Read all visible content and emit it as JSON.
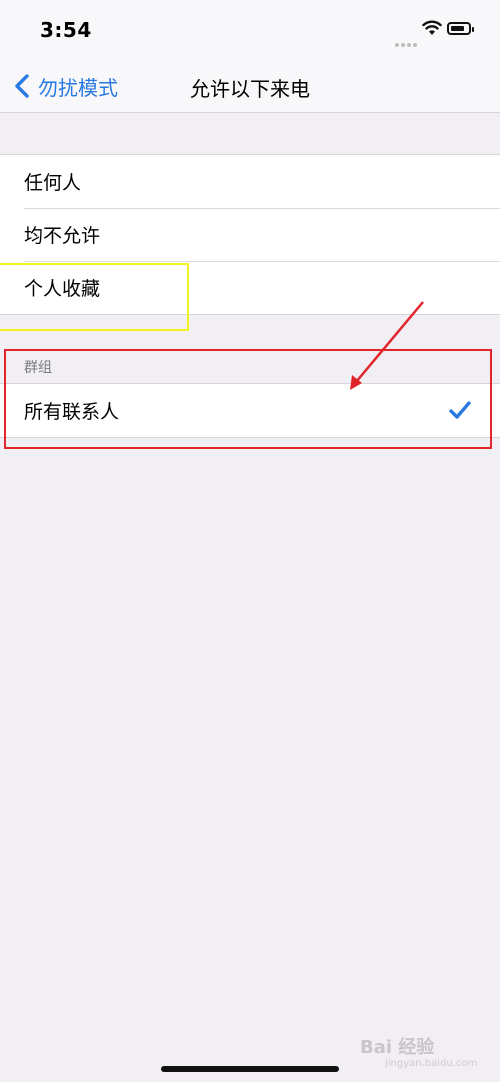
{
  "status": {
    "time": "3:54"
  },
  "nav": {
    "back_label": "勿扰模式",
    "title": "允许以下来电"
  },
  "options": [
    {
      "label": "任何人"
    },
    {
      "label": "均不允许"
    },
    {
      "label": "个人收藏"
    }
  ],
  "groups_section": {
    "header": "群组",
    "items": [
      {
        "label": "所有联系人",
        "selected": true
      }
    ]
  },
  "annotations": {
    "yellow_box_color": "#f2f21d",
    "red_box_color": "#e0252b"
  },
  "watermark": {
    "text": "Bai 经验",
    "sub": "jingyan.baidu.com"
  }
}
